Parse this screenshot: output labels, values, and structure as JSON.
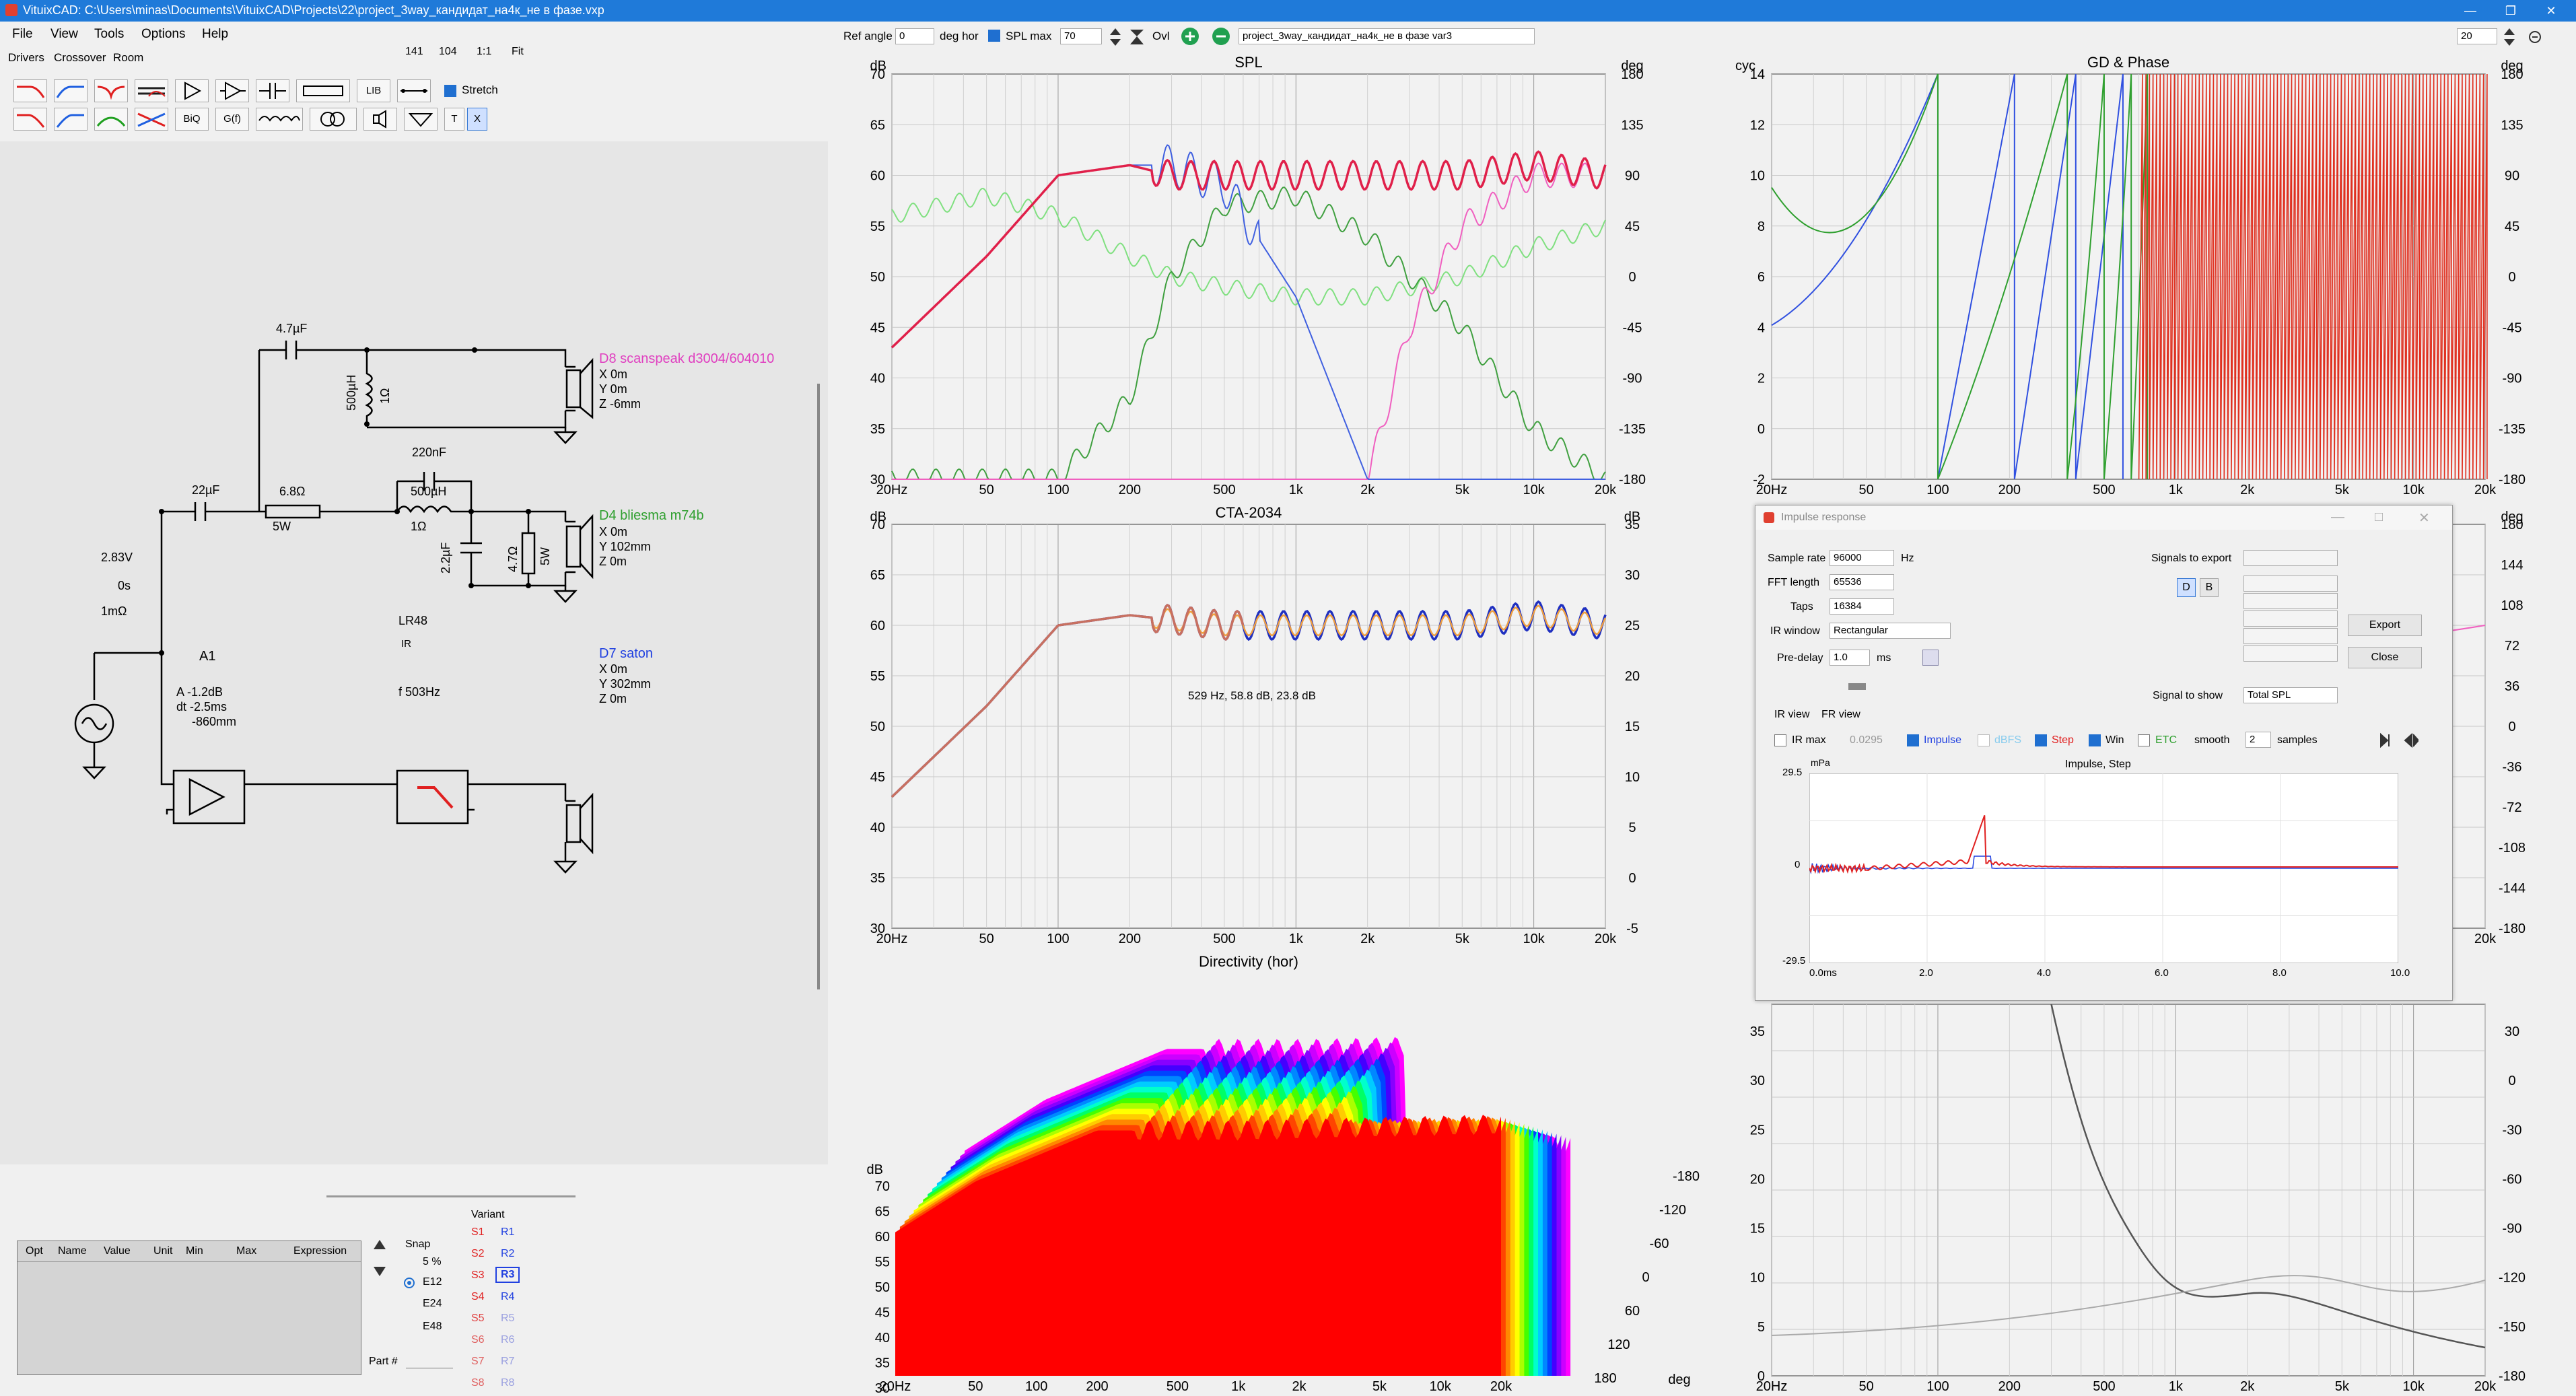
{
  "window": {
    "title": "VituixCAD: C:\\Users\\minas\\Documents\\VituixCAD\\Projects\\22\\project_3way_кандидат_на4к_не в фазе.vxp",
    "controls": [
      "—",
      "❐",
      "✕"
    ]
  },
  "menu": [
    "File",
    "View",
    "Tools",
    "Options",
    "Help"
  ],
  "tabs": [
    "Drivers",
    "Crossover",
    "Room"
  ],
  "zoom": {
    "a": "141",
    "b": "104",
    "c": "1:1",
    "d": "Fit"
  },
  "toolbar": {
    "lib": "LIB",
    "stretch": "Stretch",
    "biq": "BiQ",
    "gf": "G(f)",
    "t": "T",
    "x": "X"
  },
  "top_controls": {
    "ref_angle_label": "Ref angle",
    "ref_angle_value": "0",
    "deg_hor": "deg hor",
    "spl_max_label": "SPL max",
    "spl_max_value": "70",
    "ovl": "Ovl",
    "variant_name": "project_3way_кандидат_на4к_не в фазе var3",
    "right_value": "20"
  },
  "schematic": {
    "c1": "4.7µF",
    "l1": "500µH",
    "l1r": "1Ω",
    "d8_name": "D8 scanspeak d3004/604010",
    "d8_x": "X 0m",
    "d8_y": "Y 0m",
    "d8_z": "Z -6mm",
    "c2": "220nF",
    "c3": "22µF",
    "r1": "6.8Ω",
    "r1w": "5W",
    "l2": "500µH",
    "l2r": "1Ω",
    "c4": "2.2µF",
    "r2": "4.7Ω",
    "r2w": "5W",
    "d4_name": "D4 bliesma m74b",
    "d4_x": "X 0m",
    "d4_y": "Y 102mm",
    "d4_z": "Z 0m",
    "src_v": "2.83V",
    "src_t": "0s",
    "src_r": "1mΩ",
    "amp": "A1",
    "amp_a": "A  -1.2dB",
    "amp_dt": "dt -2.5ms",
    "amp_z": "-860mm",
    "lr": "LR48",
    "lr_ir": "IR",
    "lr_f": "f   503Hz",
    "d7_name": "D7 saton",
    "d7_x": "X 0m",
    "d7_y": "Y 302mm",
    "d7_z": "Z 0m"
  },
  "opt_table": {
    "headers": [
      "Opt",
      "Name",
      "Value",
      "Unit",
      "Min",
      "Max",
      "Expression"
    ]
  },
  "snap": {
    "title": "Snap",
    "options": [
      "5 %",
      "E12",
      "E24",
      "E48"
    ],
    "selected": "E12",
    "part_label": "Part #"
  },
  "variant": {
    "title": "Variant",
    "s": [
      "S1",
      "S2",
      "S3",
      "S4",
      "S5",
      "S6",
      "S7",
      "S8"
    ],
    "r": [
      "R1",
      "R2",
      "R3",
      "R4",
      "R5",
      "R6",
      "R7",
      "R8"
    ],
    "selected": "R3"
  },
  "charts": {
    "spl": {
      "title": "SPL",
      "y_unit": "dB",
      "y2_unit": "deg",
      "yticks": [
        "70",
        "65",
        "60",
        "55",
        "50",
        "45",
        "40",
        "35",
        "30"
      ],
      "y2ticks": [
        "180",
        "135",
        "90",
        "45",
        "0",
        "-45",
        "-90",
        "-135",
        "-180"
      ]
    },
    "gd": {
      "title": "GD & Phase",
      "y_unit": "cyc",
      "y2_unit": "deg",
      "yticks": [
        "14",
        "12",
        "10",
        "8",
        "6",
        "4",
        "2",
        "0",
        "-2"
      ],
      "y2ticks": [
        "180",
        "135",
        "90",
        "45",
        "0",
        "-45",
        "-90",
        "-135",
        "-180"
      ]
    },
    "cta": {
      "title": "CTA-2034",
      "y_unit": "dB",
      "y2_unit": "dB",
      "yticks": [
        "70",
        "65",
        "60",
        "55",
        "50",
        "45",
        "40",
        "35",
        "30"
      ],
      "y2ticks": [
        "35",
        "30",
        "25",
        "20",
        "15",
        "10",
        "5",
        "0",
        "-5"
      ],
      "annotation": "529 Hz, 58.8 dB, 23.8 dB"
    },
    "dir_title": "Directivity (hor)",
    "waterfall": {
      "y_unit": "dB",
      "yticks": [
        "70",
        "65",
        "60",
        "55",
        "50",
        "45",
        "40",
        "35",
        "30"
      ],
      "angle_ticks": [
        "-180",
        "-120",
        "-60",
        "0",
        "60",
        "120",
        "180"
      ],
      "angle_unit": "deg"
    },
    "right_mid": {
      "y_unit": "deg",
      "yticks": [
        "180",
        "144",
        "108",
        "72",
        "36",
        "0",
        "-36",
        "-72",
        "-108",
        "-144",
        "-180"
      ]
    },
    "bottom_right": {
      "yticks": [
        "35",
        "30",
        "25",
        "20",
        "15",
        "10",
        "5",
        "0"
      ],
      "y2ticks": [
        "30",
        "0",
        "-30",
        "-60",
        "-90",
        "-120",
        "-150",
        "-180"
      ]
    },
    "xticks": [
      "20Hz",
      "50",
      "100",
      "200",
      "500",
      "1k",
      "2k",
      "5k",
      "10k",
      "20k"
    ]
  },
  "chart_data": [
    {
      "type": "line",
      "title": "SPL",
      "ylabel": "dB",
      "ylim": [
        30,
        70
      ],
      "x": [
        20,
        50,
        100,
        200,
        300,
        500,
        1000,
        2000,
        5000,
        10000,
        20000
      ],
      "series": [
        {
          "values": [
            43,
            52,
            60,
            61,
            60,
            60,
            60,
            60,
            60,
            61,
            60
          ]
        },
        {
          "values": [
            43,
            52,
            60,
            61,
            61,
            59,
            48,
            30,
            30,
            30,
            30
          ]
        },
        {
          "values": [
            30,
            30,
            30,
            38,
            50,
            57,
            58,
            54,
            45,
            35,
            30
          ]
        },
        {
          "values": [
            56,
            58,
            56,
            52,
            50,
            49,
            48,
            48,
            50,
            53,
            55
          ]
        }
      ]
    },
    {
      "type": "line",
      "title": "CTA-2034",
      "ylabel": "dB",
      "ylim": [
        30,
        70
      ],
      "x": [
        20,
        50,
        100,
        200,
        500,
        1000,
        2000,
        5000,
        10000,
        20000
      ],
      "series": [
        {
          "values": [
            43,
            52,
            60,
            61,
            60,
            60,
            60,
            60,
            61,
            60
          ]
        }
      ]
    }
  ],
  "impulse": {
    "title": "Impulse response",
    "sample_rate_label": "Sample rate",
    "sample_rate": "96000",
    "hz": "Hz",
    "fft_label": "FFT length",
    "fft": "65536",
    "taps_label": "Taps",
    "taps": "16384",
    "ir_window_label": "IR window",
    "ir_window": "Rectangular",
    "predelay_label": "Pre-delay",
    "predelay": "1.0",
    "ms": "ms",
    "signals_export": "Signals to export",
    "d": "D",
    "b": "B",
    "export": "Export",
    "close": "Close",
    "signal_show_label": "Signal to show",
    "signal_show": "Total SPL",
    "ir_view": "IR view",
    "fr_view": "FR view",
    "ir_max": "IR max",
    "ir_max_val": "0.0295",
    "impulse": "Impulse",
    "dbfs": "dBFS",
    "step": "Step",
    "win": "Win",
    "etc": "ETC",
    "smooth": "smooth",
    "smooth_val": "2",
    "samples": "samples",
    "plot_title": "Impulse, Step",
    "unit": "mPa",
    "ytop": "29.5",
    "ymid": "0",
    "ybot": "-29.5",
    "xticks": [
      "0.0ms",
      "2.0",
      "4.0",
      "6.0",
      "8.0",
      "10.0"
    ]
  }
}
